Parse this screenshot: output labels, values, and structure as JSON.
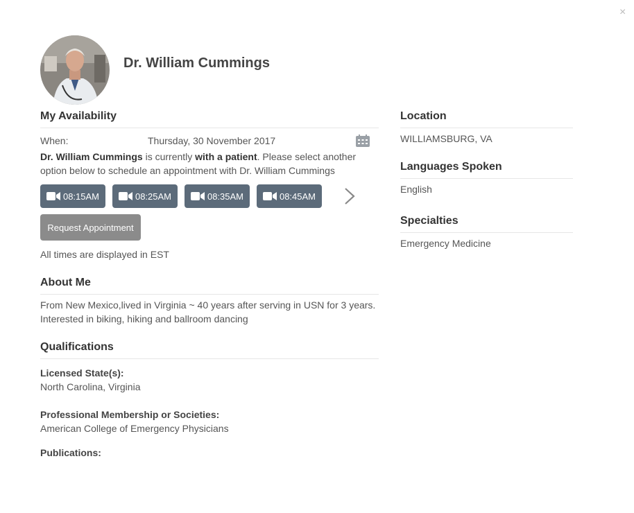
{
  "modal": {
    "close_label": "×"
  },
  "doctor": {
    "name": "Dr. William Cummings"
  },
  "availability": {
    "title": "My Availability",
    "when_label": "When:",
    "date": "Thursday, 30 November 2017",
    "status_name": "Dr. William Cummings",
    "status_mid": " is currently ",
    "status_state": "with a patient",
    "status_tail": ". Please select another option below to schedule an appointment with Dr. William Cummings",
    "slots": [
      "08:15AM",
      "08:25AM",
      "08:35AM",
      "08:45AM"
    ],
    "request_label": "Request Appointment",
    "timezone_note": "All times are displayed in EST"
  },
  "about": {
    "title": "About Me",
    "text": "From New Mexico,lived in Virginia ~ 40 years after serving in USN for 3 years. Interested in biking, hiking and ballroom dancing"
  },
  "qualifications": {
    "title": "Qualifications",
    "licensed_label": "Licensed State(s):",
    "licensed_value": "North Carolina, Virginia",
    "membership_label": "Professional Membership or Societies:",
    "membership_value": "American College of Emergency Physicians",
    "publications_label": "Publications:"
  },
  "sidebar": {
    "location_title": "Location",
    "location_value": "WILLIAMSBURG, VA",
    "languages_title": "Languages Spoken",
    "languages_value": "English",
    "specialties_title": "Specialties",
    "specialties_value": "Emergency Medicine"
  },
  "icons": {
    "close": "close-icon",
    "video": "video-camera-icon",
    "calendar": "calendar-icon",
    "next": "chevron-right-icon"
  },
  "colors": {
    "slot_button": "#5c6b7a",
    "request_button": "#8b8b8b",
    "heading": "#333333",
    "text": "#555555"
  }
}
